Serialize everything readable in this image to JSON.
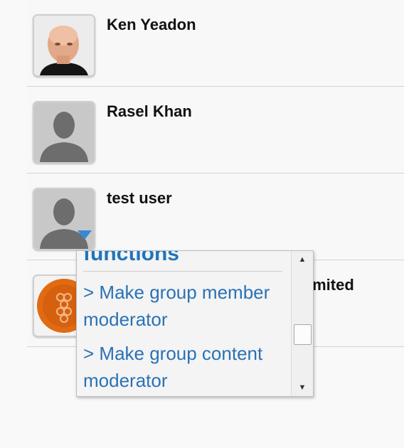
{
  "members": [
    {
      "name": "Ken Yeadon",
      "avatar": "person-photo"
    },
    {
      "name": "Rasel Khan",
      "avatar": "default-user-icon"
    },
    {
      "name": "test user",
      "avatar": "default-user-icon"
    },
    {
      "name": "imited",
      "avatar": "orange-logo-icon"
    }
  ],
  "popup": {
    "title": "functions",
    "items": [
      "> Make group member moderator",
      "> Make group content moderator"
    ]
  },
  "colors": {
    "link": "#2a72b5",
    "title": "#1f74bd",
    "trigger": "#3a87d6"
  }
}
